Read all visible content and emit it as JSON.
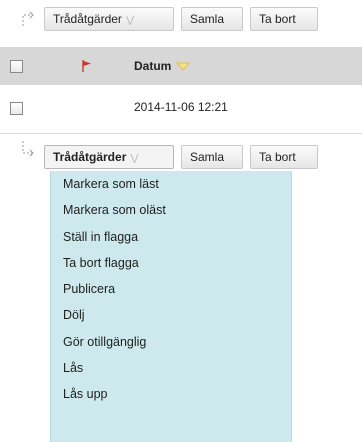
{
  "toolbar_top": {
    "thread_tools_label": "Trådåtgärder",
    "collect_label": "Samla",
    "delete_label": "Ta bort"
  },
  "header": {
    "date_label": "Datum"
  },
  "rows": [
    {
      "date": "2014-11-06 12:21"
    }
  ],
  "toolbar_bottom": {
    "thread_tools_label": "Trådåtgärder",
    "collect_label": "Samla",
    "delete_label": "Ta bort"
  },
  "menu": {
    "items": [
      {
        "label": "Markera som läst"
      },
      {
        "label": "Markera som oläst"
      },
      {
        "label": "Ställ in flagga"
      },
      {
        "label": "Ta bort flagga"
      },
      {
        "label": "Publicera"
      },
      {
        "label": "Dölj"
      },
      {
        "label": "Gör otillgänglig"
      },
      {
        "label": "Lås"
      },
      {
        "label": "Lås upp"
      }
    ]
  },
  "colors": {
    "header_bg": "#d7d7d7",
    "menu_bg": "#cde9ee",
    "flag": "#c0392b",
    "sort_arrow": "#f2c94c"
  },
  "icons": [
    "tree-branch-icon",
    "flag-icon",
    "sort-desc-icon",
    "chevron-down-icon"
  ]
}
